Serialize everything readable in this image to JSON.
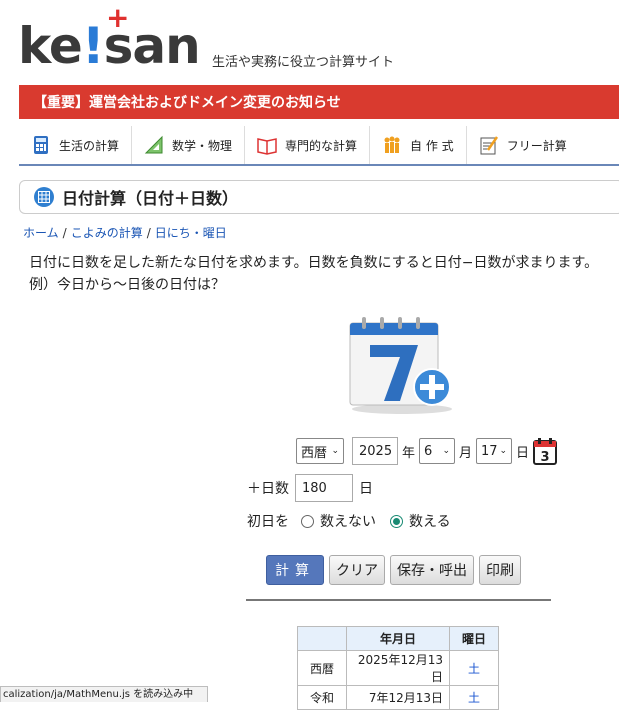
{
  "header": {
    "logo_text_pre": "ke",
    "logo_bang": "!",
    "logo_text_post": "san",
    "logo_plus": "+",
    "tagline": "生活や実務に役立つ計算サイト"
  },
  "notice": {
    "text": "【重要】運営会社およびドメイン変更のお知らせ"
  },
  "nav": {
    "items": [
      {
        "label": "生活の計算",
        "icon": "calculator-icon"
      },
      {
        "label": "数学・物理",
        "icon": "triangle-ruler-icon"
      },
      {
        "label": "専門的な計算",
        "icon": "book-icon"
      },
      {
        "label": "自 作 式",
        "icon": "people-icon"
      },
      {
        "label": "フリー計算",
        "icon": "notepad-icon"
      }
    ]
  },
  "page": {
    "title": "日付計算（日付＋日数）",
    "breadcrumb": [
      "ホーム",
      "こよみの計算",
      "日にち・曜日"
    ],
    "description": "日付に日数を足した新たな日付を求めます。日数を負数にすると日付−日数が求まります。",
    "example": "例）今日から〜日後の日付は？"
  },
  "form": {
    "era_value": "西暦",
    "year_value": "2025",
    "year_suffix": "年",
    "month_value": "6",
    "month_suffix": "月",
    "day_value": "17",
    "day_suffix": "日",
    "calendar_icon_number": "3",
    "days_label": "＋日数",
    "days_value": "180",
    "days_suffix": "日",
    "first_day_label": "初日を",
    "option_exclude": "数えない",
    "option_include": "数える",
    "first_day_selected": "include"
  },
  "buttons": {
    "calculate": "計算",
    "clear": "クリア",
    "save_load": "保存・呼出",
    "print": "印刷"
  },
  "result": {
    "headers": [
      "",
      "年月日",
      "曜日"
    ],
    "rows": [
      {
        "era": "西暦",
        "date": "2025年12月13日",
        "weekday": "土"
      },
      {
        "era": "令和",
        "date": "7年12月13日",
        "weekday": "土"
      }
    ]
  },
  "status_bar": {
    "text": "calization/ja/MathMenu.js を読み込み中"
  },
  "colors": {
    "notice_bg": "#d93a2f",
    "primary_button": "#5577bb",
    "link": "#1a55b4",
    "logo_accent": "#e0312f"
  }
}
